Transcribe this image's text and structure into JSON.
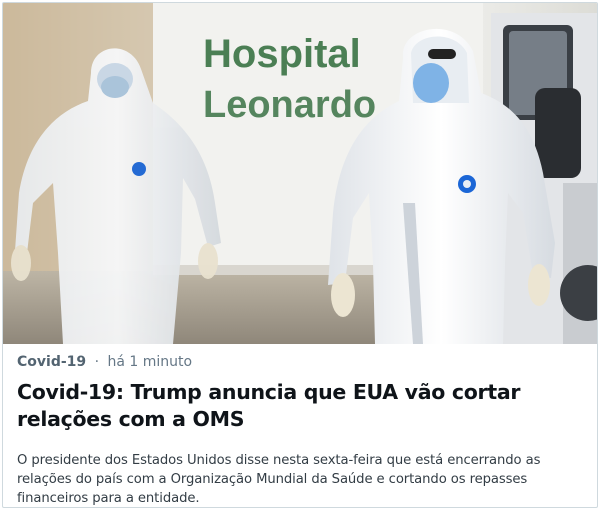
{
  "article": {
    "image_alt": "",
    "sign_line1": "Hospital",
    "sign_line2": "Leonardo",
    "category": "Covid-19",
    "separator": "·",
    "time": "há 1 minuto",
    "headline": "Covid-19: Trump anuncia que EUA vão cortar relações com a OMS",
    "summary": "O presidente dos Estados Unidos disse nesta sexta-feira que está encerrando as relações do país com a Organização Mundial da Saúde e cortando os repasses financeiros para a entidade."
  },
  "colors": {
    "sign_text": "#2f6b3a",
    "category": "#536471",
    "headline": "#0f1419",
    "summary": "#333d45",
    "badge": "#1b66d6"
  }
}
